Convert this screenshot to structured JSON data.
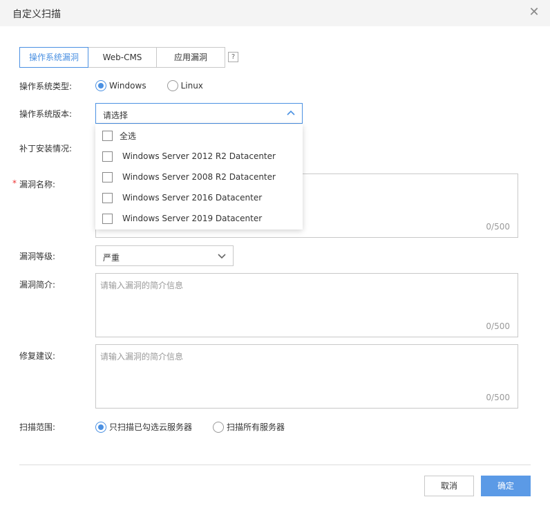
{
  "dialog": {
    "title": "自定义扫描",
    "close_glyph": "✕"
  },
  "tabs": [
    {
      "label": "操作系统漏洞",
      "active": true
    },
    {
      "label": "Web-CMS",
      "active": false
    },
    {
      "label": "应用漏洞",
      "active": false
    }
  ],
  "help_glyph": "?",
  "os_type": {
    "label": "操作系统类型:",
    "options": [
      {
        "label": "Windows",
        "checked": true
      },
      {
        "label": "Linux",
        "checked": false
      }
    ]
  },
  "os_version": {
    "label": "操作系统版本:",
    "placeholder": "请选择",
    "dropdown": [
      {
        "label": "全选",
        "checked": false
      },
      {
        "label": "Windows Server 2012 R2 Datacenter",
        "checked": false
      },
      {
        "label": "Windows Server 2008 R2 Datacenter",
        "checked": false
      },
      {
        "label": "Windows Server 2016 Datacenter",
        "checked": false
      },
      {
        "label": "Windows Server 2019 Datacenter",
        "checked": false
      }
    ]
  },
  "patch": {
    "label": "补丁安装情况:"
  },
  "vuln_name": {
    "label": "漏洞名称:",
    "required_mark": "*",
    "count": "0/500"
  },
  "vuln_level": {
    "label": "漏洞等级:",
    "value": "严重"
  },
  "vuln_desc": {
    "label": "漏洞简介:",
    "placeholder": "请输入漏洞的简介信息",
    "count": "0/500"
  },
  "fix_advice": {
    "label": "修复建议:",
    "placeholder": "请输入漏洞的简介信息",
    "count": "0/500"
  },
  "scan_scope": {
    "label": "扫描范围:",
    "options": [
      {
        "label": "只扫描已勾选云服务器",
        "checked": true
      },
      {
        "label": "扫描所有服务器",
        "checked": false
      }
    ]
  },
  "footer": {
    "cancel_label": "取消",
    "ok_label": "确定"
  },
  "colors": {
    "accent": "#4a90e2",
    "primary_button": "#5b9ae6",
    "header_bg": "#f4f4f4",
    "required": "#e33333"
  }
}
